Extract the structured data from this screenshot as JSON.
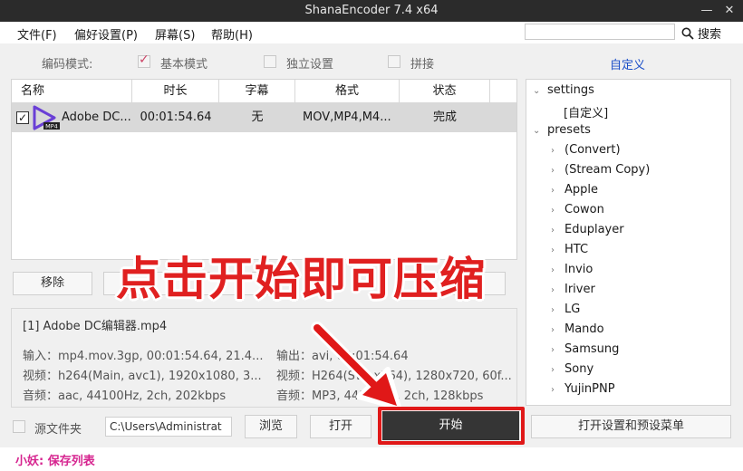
{
  "window": {
    "title": "ShanaEncoder 7.4 x64",
    "minimize": "—",
    "close": "✕"
  },
  "menu": {
    "items": [
      "文件(F)",
      "偏好设置(P)",
      "屏幕(S)",
      "帮助(H)"
    ],
    "search_label": "搜索"
  },
  "mode": {
    "label": "编码模式:",
    "basic": "基本模式",
    "independent": "独立设置",
    "splice": "拼接",
    "custom": "自定义"
  },
  "list": {
    "columns": [
      "名称",
      "时长",
      "字幕",
      "格式",
      "状态"
    ],
    "rows": [
      {
        "name": "Adobe DC...",
        "duration": "00:01:54.64",
        "subtitle": "无",
        "format": "MOV,MP4,M4...",
        "status": "完成",
        "icon_badge": "MP4"
      }
    ]
  },
  "actions": {
    "remove": "移除"
  },
  "overlay": {
    "text": "点击开始即可压缩"
  },
  "info": {
    "title": "[1] Adobe DC编辑器.mp4",
    "input": "输入：mp4.mov.3gp, 00:01:54.64, 21.4...",
    "video_in": "视频：h264(Main, avc1), 1920x1080, 3...",
    "audio_in": "音频：aac, 44100Hz, 2ch, 202kbps",
    "output": "输出：avi, 00:01:54.64",
    "video_out": "视频：H264(SW: x264), 1280x720, 60f...",
    "audio_out": "音频：MP3, 44100Hz, 2ch, 128kbps"
  },
  "tree": {
    "settings": "settings",
    "custom": "[自定义]",
    "presets": "presets",
    "preset_items": [
      "(Convert)",
      "(Stream Copy)",
      "Apple",
      "Cowon",
      "Eduplayer",
      "HTC",
      "Invio",
      "Iriver",
      "LG",
      "Mando",
      "Samsung",
      "Sony",
      "YujinPNP"
    ]
  },
  "bottom": {
    "source_folder": "源文件夹",
    "path": "C:\\Users\\Administrat",
    "browse": "浏览",
    "open": "打开",
    "start": "开始",
    "settings_menu": "打开设置和预设菜单"
  },
  "status": {
    "text": "小妖: 保存列表"
  },
  "colors": {
    "accent_red": "#e01818",
    "status_pink": "#d6248f",
    "link_blue": "#1a4ec8"
  }
}
